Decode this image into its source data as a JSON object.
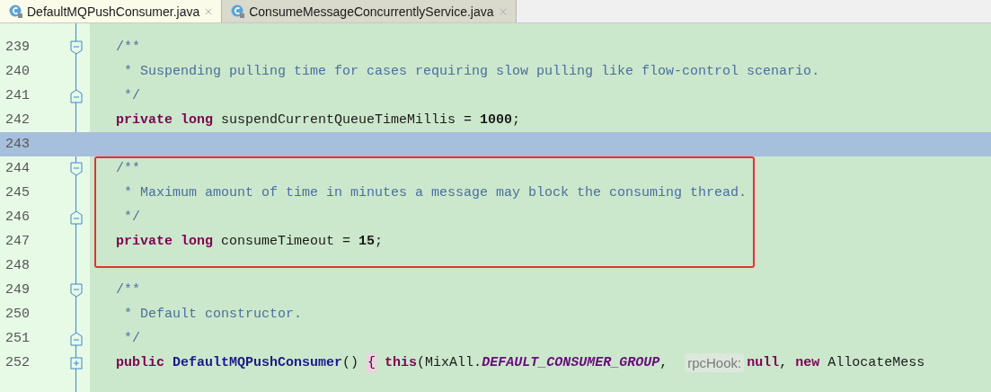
{
  "tabs": [
    {
      "label": "DefaultMQPushConsumer.java",
      "selected": true
    },
    {
      "label": "ConsumeMessageConcurrentlyService.java",
      "selected": false
    }
  ],
  "sections": [
    {
      "framed": false,
      "lines": [
        {
          "number": "239",
          "kind": "fold-start",
          "current": false,
          "tokens": [
            {
              "kind": "comment",
              "text": "/**"
            }
          ]
        },
        {
          "number": "240",
          "kind": "plain",
          "current": false,
          "tokens": [
            {
              "kind": "comment",
              "text": " * Suspending pulling time for cases requiring slow pulling like flow-control scenario."
            }
          ]
        },
        {
          "number": "241",
          "kind": "fold-end",
          "current": false,
          "tokens": [
            {
              "kind": "comment",
              "text": " */"
            }
          ]
        },
        {
          "number": "242",
          "kind": "plain",
          "current": false,
          "tokens": [
            {
              "kind": "keyword",
              "text": "private long"
            },
            {
              "kind": "plain",
              "text": " suspendCurrentQueueTimeMillis = "
            },
            {
              "kind": "number",
              "text": "1000"
            },
            {
              "kind": "plain",
              "text": ";"
            }
          ]
        },
        {
          "number": "243",
          "kind": "plain",
          "current": true
        }
      ]
    },
    {
      "framed": true,
      "color": "#e8312c",
      "lines": [
        {
          "number": "244",
          "kind": "fold-start",
          "current": false,
          "tokens": [
            {
              "kind": "comment",
              "text": "/**"
            }
          ]
        },
        {
          "number": "245",
          "kind": "plain",
          "current": false,
          "tokens": [
            {
              "kind": "comment",
              "text": " * Maximum amount of time in minutes a message may block the consuming thread."
            }
          ]
        },
        {
          "number": "246",
          "kind": "fold-end",
          "current": false,
          "tokens": [
            {
              "kind": "comment",
              "text": " */"
            }
          ]
        },
        {
          "number": "247",
          "kind": "plain",
          "current": false,
          "tokens": [
            {
              "kind": "keyword",
              "text": "private long"
            },
            {
              "kind": "plain",
              "text": " consumeTimeout = "
            },
            {
              "kind": "number",
              "text": "15"
            },
            {
              "kind": "plain",
              "text": ";"
            }
          ]
        }
      ]
    },
    {
      "framed": false,
      "lines": [
        {
          "number": "248",
          "kind": "plain",
          "current": false
        },
        {
          "number": "249",
          "kind": "fold-start",
          "current": false,
          "tokens": [
            {
              "kind": "comment",
              "text": "/**"
            }
          ]
        },
        {
          "number": "250",
          "kind": "plain",
          "current": false,
          "tokens": [
            {
              "kind": "comment",
              "text": " * Default constructor."
            }
          ]
        },
        {
          "number": "251",
          "kind": "fold-end",
          "current": false,
          "tokens": [
            {
              "kind": "comment",
              "text": " */"
            }
          ]
        },
        {
          "number": "252",
          "kind": "collapsed",
          "current": false,
          "tokens": [
            {
              "kind": "keyword",
              "text": "public"
            },
            {
              "kind": "method",
              "text": " DefaultMQPushConsumer"
            },
            {
              "kind": "plain",
              "text": "() "
            },
            {
              "kind": "brace",
              "text": "{"
            },
            {
              "kind": "keyword",
              "text": " this"
            },
            {
              "kind": "plain",
              "text": "(MixAll."
            },
            {
              "kind": "constant",
              "text": "DEFAULT_CONSUMER_GROUP"
            },
            {
              "kind": "plain",
              "text": ", "
            },
            {
              "kind": "hint",
              "text": "rpcHook:"
            },
            {
              "kind": "keyword",
              "text": "null"
            },
            {
              "kind": "plain",
              "text": ", "
            },
            {
              "kind": "keyword",
              "text": "new"
            },
            {
              "kind": "plain",
              "text": " AllocateMess"
            }
          ]
        }
      ]
    }
  ]
}
